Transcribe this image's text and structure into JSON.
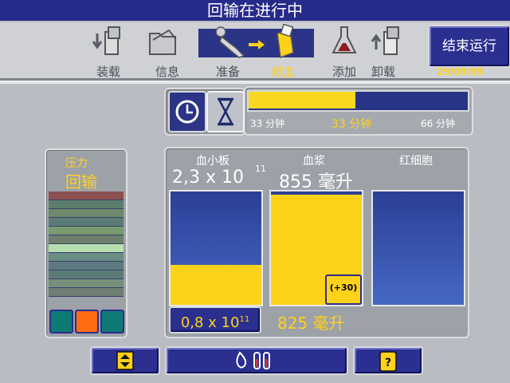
{
  "header": {
    "title": "回输在进行中"
  },
  "steps": [
    {
      "label": "装载",
      "icon": "load-cassette-icon",
      "active": false
    },
    {
      "label": "信息",
      "icon": "folder-info-icon",
      "active": false
    },
    {
      "label": "准备",
      "icon": "donor-prepare-icon",
      "active": false
    },
    {
      "label": "献血",
      "icon": "donate-cassette-icon",
      "active": true
    },
    {
      "label": "添加",
      "icon": "add-solution-flask-icon",
      "active": false
    },
    {
      "label": "卸载",
      "icon": "unload-cassette-icon",
      "active": false
    }
  ],
  "end_button": {
    "label": "结束运行"
  },
  "date": "29/09/95",
  "timer": {
    "progress": 0.49,
    "elapsed": "33 分钟",
    "remaining": "33 分钟",
    "total": "66 分钟",
    "mode_icons": [
      "clock-icon",
      "hourglass-icon"
    ]
  },
  "pressure": {
    "label": "压力",
    "state": "回输",
    "bands": [
      "#8d5050",
      "#5c7c6c",
      "#6e8a6a",
      "#5e7c77",
      "#7a9a70",
      "#6d7f6d",
      "#b7e0b0",
      "#6a8d84",
      "#5d7a80",
      "#5c7b76",
      "#758f7a",
      "#6f7f73"
    ],
    "indicators": [
      {
        "color": "#0f7a73"
      },
      {
        "color": "#ff6c12"
      },
      {
        "color": "#0f7a73"
      }
    ]
  },
  "products": {
    "platelets": {
      "label": "血小板",
      "value": "2,3 x 10",
      "exp": "11",
      "fill": 0.35,
      "current": "0,8 x 10",
      "current_exp": "11"
    },
    "plasma": {
      "label": "血浆",
      "value": "855 毫升",
      "fill": 0.97,
      "badge": "(+30)",
      "current": "825 毫升"
    },
    "rbc": {
      "label": "红细胞",
      "fill": 0.0
    }
  },
  "footer": {
    "buttons": [
      "scroll-updown-icon",
      "drop-tubes-icon",
      "help-bag-icon"
    ]
  }
}
